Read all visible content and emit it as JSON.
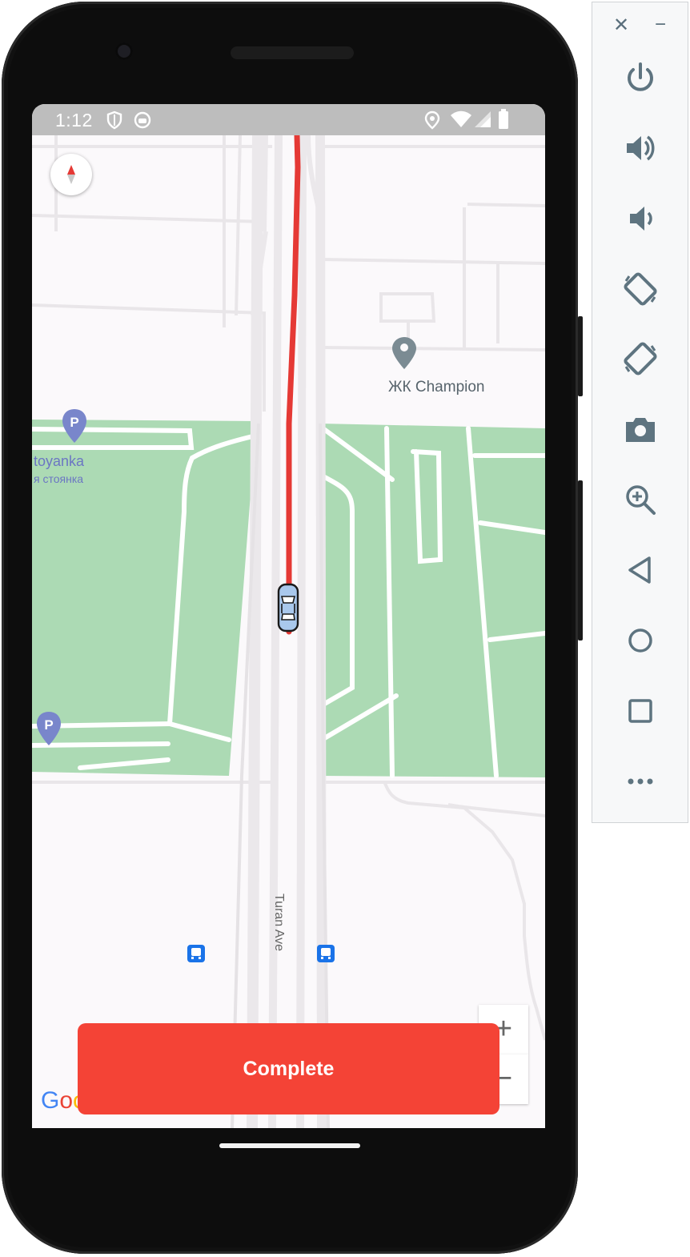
{
  "status_bar": {
    "time": "1:12",
    "icons": [
      "shield-icon",
      "face-icon",
      "location-pin-icon",
      "wifi-icon",
      "cell-signal-icon",
      "battery-icon"
    ]
  },
  "map": {
    "place_label": "ЖК Champion",
    "parking_label_1": "toyanka",
    "parking_label_2": "я стоянка",
    "street_label": "Turan Ave",
    "google_letters": [
      "G",
      "o",
      "o",
      "g"
    ],
    "google_colors": [
      "#4285F4",
      "#EA4335",
      "#FBBC05",
      "#4285F4"
    ],
    "park_color": "#acdab4",
    "route_color": "#e53935",
    "zoom_in": "+",
    "zoom_out": "−"
  },
  "action": {
    "complete_label": "Complete",
    "complete_color": "#f44336"
  },
  "emulator": {
    "close_label": "✕",
    "minimize_label": "−",
    "buttons": [
      "power",
      "volume-up",
      "volume-down",
      "rotate-left",
      "rotate-right",
      "camera",
      "zoom",
      "back",
      "home",
      "overview",
      "more"
    ]
  }
}
